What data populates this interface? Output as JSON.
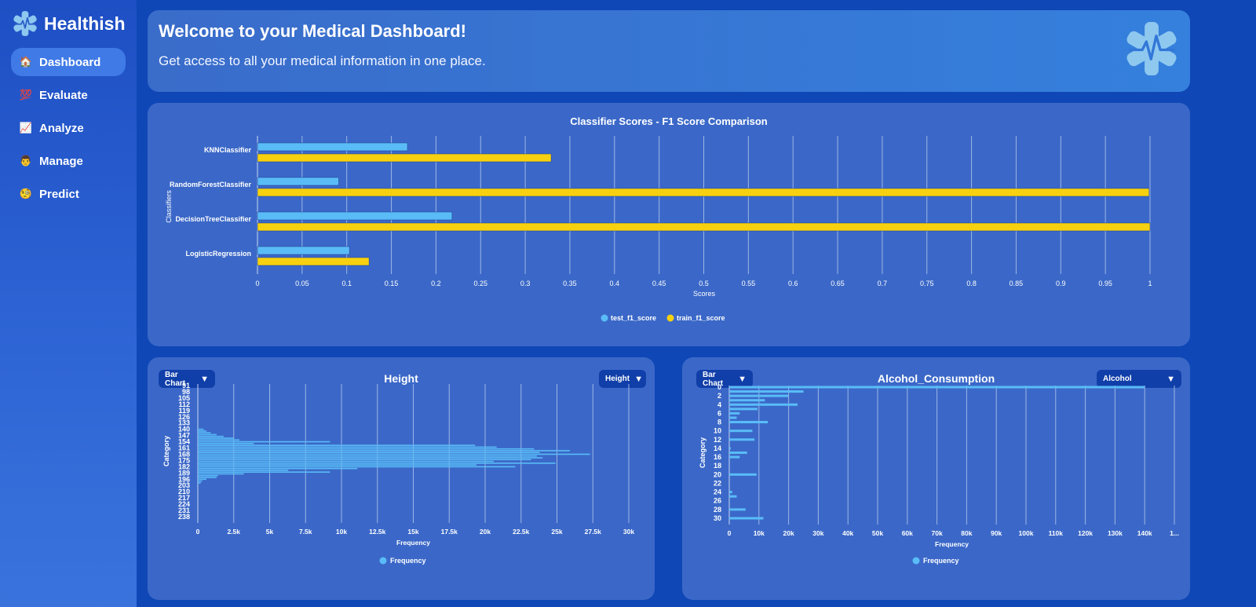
{
  "app": {
    "name": "Healthish"
  },
  "sidebar": {
    "items": [
      {
        "label": "Dashboard",
        "icon": "house-icon",
        "glyph": "🏠",
        "active": true
      },
      {
        "label": "Evaluate",
        "icon": "hundred-points-icon",
        "glyph": "💯",
        "active": false
      },
      {
        "label": "Analyze",
        "icon": "chart-increasing-icon",
        "glyph": "📈",
        "active": false
      },
      {
        "label": "Manage",
        "icon": "person-icon",
        "glyph": "👨",
        "active": false
      },
      {
        "label": "Predict",
        "icon": "monocle-face-icon",
        "glyph": "🧐",
        "active": false
      }
    ]
  },
  "welcome": {
    "title": "Welcome to your Medical Dashboard!",
    "subtitle": "Get access to all your medical information in one place."
  },
  "colors": {
    "test": "#5abcf7",
    "train": "#f7d10f",
    "freq": "#5abcf7",
    "logo": "#8ec8ef"
  },
  "height_panel": {
    "chart_type_label": "Bar Chart",
    "column_label": "Height",
    "title": "Height"
  },
  "alcohol_panel": {
    "chart_type_label": "Bar Chart",
    "column_label": "Alcohol",
    "title": "Alcohol_Consumption"
  },
  "chart_data": [
    {
      "type": "bar",
      "orientation": "horizontal",
      "title": "Classifier Scores - F1 Score Comparison",
      "xlabel": "Scores",
      "ylabel": "Classifiers",
      "categories": [
        "KNNClassifier",
        "RandomForestClassifier",
        "DecisionTreeClassifier",
        "LogisticRegression"
      ],
      "series": [
        {
          "name": "test_f1_score",
          "values": [
            0.168,
            0.091,
            0.218,
            0.103
          ]
        },
        {
          "name": "train_f1_score",
          "values": [
            0.329,
            0.999,
            1.0,
            0.125
          ]
        }
      ],
      "xlim": [
        0,
        1
      ],
      "xticks": [
        "0",
        "0.05",
        "0.1",
        "0.15",
        "0.2",
        "0.25",
        "0.3",
        "0.35",
        "0.4",
        "0.45",
        "0.5",
        "0.55",
        "0.6",
        "0.65",
        "0.7",
        "0.75",
        "0.8",
        "0.85",
        "0.9",
        "0.95",
        "1"
      ],
      "grid": true,
      "legend": "bottom-center"
    },
    {
      "type": "bar",
      "orientation": "horizontal",
      "xlabel": "Frequency",
      "ylabel": "Category",
      "y_tick_labels": [
        "91",
        "98",
        "105",
        "112",
        "119",
        "126",
        "133",
        "140",
        "147",
        "154",
        "161",
        "168",
        "175",
        "182",
        "189",
        "196",
        "203",
        "210",
        "217",
        "224",
        "231",
        "238"
      ],
      "series": [
        {
          "name": "Frequency"
        }
      ],
      "values": [
        {
          "y": 140,
          "x": 400
        },
        {
          "y": 142,
          "x": 600
        },
        {
          "y": 144,
          "x": 900
        },
        {
          "y": 146,
          "x": 1300
        },
        {
          "y": 148,
          "x": 1800
        },
        {
          "y": 150,
          "x": 2500
        },
        {
          "y": 152,
          "x": 2900
        },
        {
          "y": 154,
          "x": 9200
        },
        {
          "y": 156,
          "x": 3900
        },
        {
          "y": 158,
          "x": 19300
        },
        {
          "y": 160,
          "x": 20800
        },
        {
          "y": 162,
          "x": 23400
        },
        {
          "y": 164,
          "x": 25900
        },
        {
          "y": 166,
          "x": 23800
        },
        {
          "y": 168,
          "x": 27300
        },
        {
          "y": 170,
          "x": 23600
        },
        {
          "y": 172,
          "x": 24000
        },
        {
          "y": 174,
          "x": 23200
        },
        {
          "y": 176,
          "x": 20600
        },
        {
          "y": 178,
          "x": 24900
        },
        {
          "y": 180,
          "x": 19400
        },
        {
          "y": 182,
          "x": 22100
        },
        {
          "y": 184,
          "x": 11100
        },
        {
          "y": 186,
          "x": 6300
        },
        {
          "y": 188,
          "x": 9200
        },
        {
          "y": 190,
          "x": 3200
        },
        {
          "y": 192,
          "x": 1400
        },
        {
          "y": 194,
          "x": 1300
        },
        {
          "y": 196,
          "x": 600
        },
        {
          "y": 198,
          "x": 300
        },
        {
          "y": 200,
          "x": 200
        }
      ],
      "xlim": [
        0,
        30000
      ],
      "xticks": [
        "0",
        "2.5k",
        "5k",
        "7.5k",
        "10k",
        "12.5k",
        "15k",
        "17.5k",
        "20k",
        "22.5k",
        "25k",
        "27.5k",
        "30k"
      ],
      "grid": true,
      "legend": "bottom-center"
    },
    {
      "type": "bar",
      "orientation": "horizontal",
      "xlabel": "Frequency",
      "ylabel": "Category",
      "y_tick_labels": [
        "0",
        "2",
        "4",
        "6",
        "8",
        "10",
        "12",
        "14",
        "16",
        "18",
        "20",
        "22",
        "24",
        "26",
        "28",
        "30"
      ],
      "series": [
        {
          "name": "Frequency"
        }
      ],
      "values": [
        {
          "y": 0,
          "x": 140000
        },
        {
          "y": 1,
          "x": 25000
        },
        {
          "y": 2,
          "x": 20000
        },
        {
          "y": 3,
          "x": 12000
        },
        {
          "y": 4,
          "x": 23000
        },
        {
          "y": 5,
          "x": 9500
        },
        {
          "y": 6,
          "x": 3500
        },
        {
          "y": 7,
          "x": 2500
        },
        {
          "y": 8,
          "x": 13000
        },
        {
          "y": 10,
          "x": 7800
        },
        {
          "y": 12,
          "x": 8500
        },
        {
          "y": 14,
          "x": 500
        },
        {
          "y": 15,
          "x": 6000
        },
        {
          "y": 16,
          "x": 3500
        },
        {
          "y": 20,
          "x": 9200
        },
        {
          "y": 24,
          "x": 1000
        },
        {
          "y": 25,
          "x": 2500
        },
        {
          "y": 28,
          "x": 5500
        },
        {
          "y": 30,
          "x": 11500
        }
      ],
      "xlim": [
        0,
        150000
      ],
      "xticks": [
        "0",
        "10k",
        "20k",
        "30k",
        "40k",
        "50k",
        "60k",
        "70k",
        "80k",
        "90k",
        "100k",
        "110k",
        "120k",
        "130k",
        "140k",
        "1..."
      ],
      "grid": true,
      "legend": "bottom-center"
    }
  ]
}
